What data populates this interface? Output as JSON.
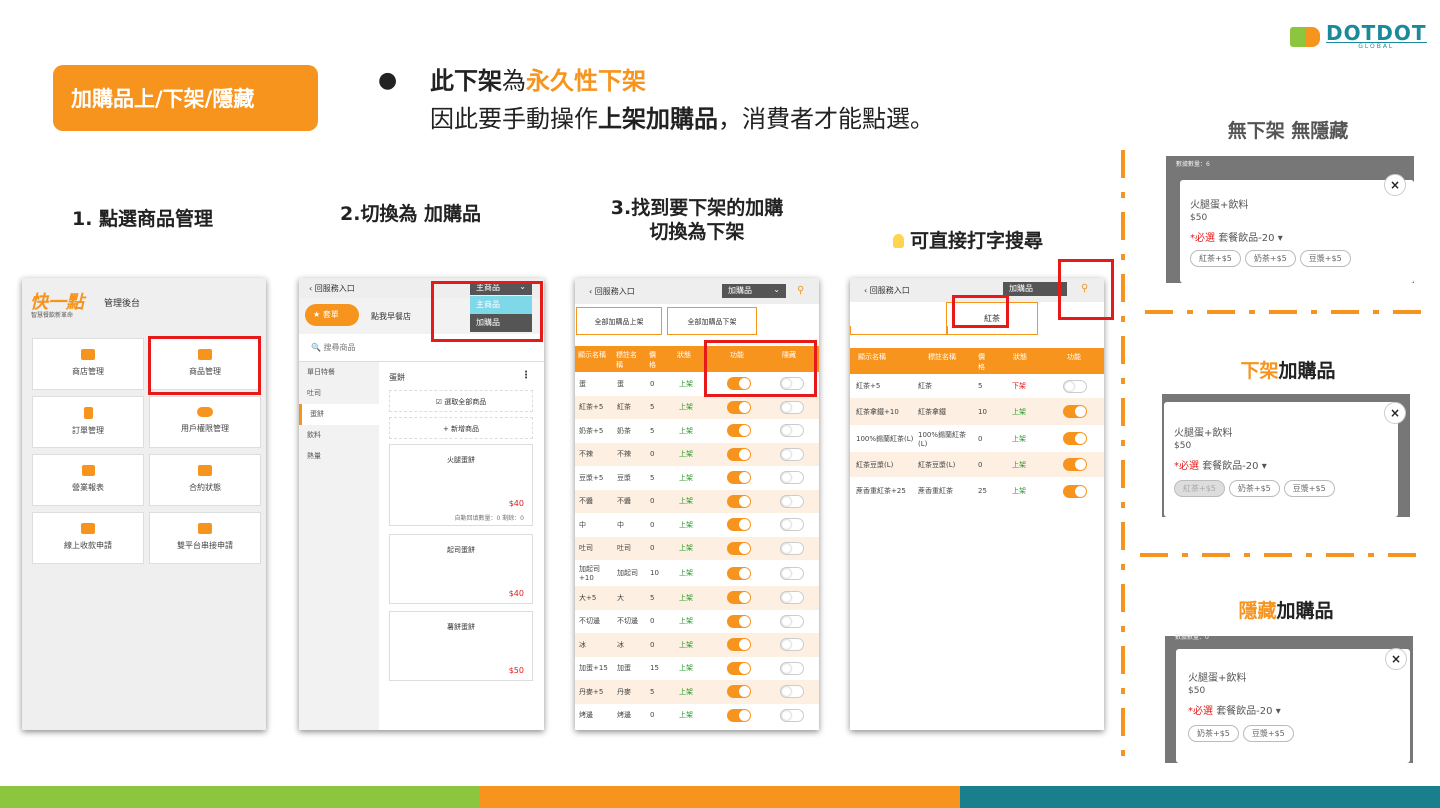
{
  "title_button": "加購品上/下架/隱藏",
  "bullet": {
    "l1_a": "此下架",
    "l1_b": "為",
    "l1_c": "永久性下架",
    "l2_a": "因此要手動操作",
    "l2_b": "上架加購品",
    "l2_c": "，消費者才能點選。"
  },
  "logo": {
    "name": "DOTDOT",
    "sub": "GLOBAL"
  },
  "steps": {
    "s1": "1. 點選商品管理",
    "s2": "2.切換為 加購品",
    "s3a": "3.找到要下架的加購",
    "s3b": "切換為下架",
    "s4": "可直接打字搜尋"
  },
  "panel1": {
    "brand": "快一點",
    "brand_sub": "智慧餐飲新革命",
    "manager": "管理後台",
    "tiles": [
      "商店管理",
      "商品管理",
      "訂單管理",
      "用戶權限管理",
      "營業報表",
      "合約狀態",
      "線上收款申請",
      "雙平台串接申請"
    ]
  },
  "panel2": {
    "back": "回服務入口",
    "select": "主商品",
    "options": [
      "主商品",
      "加購品"
    ],
    "star_tab": "套單",
    "tab2": "點我早餐店",
    "search": "搜尋商品",
    "side": [
      "單日特餐",
      "吐司",
      "蛋餅",
      "飲料",
      "熱量"
    ],
    "section": "蛋餅",
    "select_all": "選取全部商品",
    "add_item": "+ 新增商品",
    "cards": [
      {
        "name": "火腿蛋餅",
        "price": "$40",
        "note": "自動回填數量：0   剩餘：0"
      },
      {
        "name": "起司蛋餅",
        "price": "$40"
      },
      {
        "name": "薯餅蛋餅",
        "price": "$50"
      }
    ]
  },
  "panel3": {
    "back": "回服務入口",
    "select": "加購品",
    "btn_up": "全部加購品上架",
    "btn_down": "全部加購品下架",
    "headers": [
      "顯示名稱",
      "標註名稱",
      "價格",
      "狀態",
      "功能",
      "隱藏"
    ],
    "rows": [
      [
        "蛋",
        "蛋",
        "0",
        "上架"
      ],
      [
        "紅茶+5",
        "紅茶",
        "5",
        "上架"
      ],
      [
        "奶茶+5",
        "奶茶",
        "5",
        "上架"
      ],
      [
        "不辣",
        "不辣",
        "0",
        "上架"
      ],
      [
        "豆漿+5",
        "豆漿",
        "5",
        "上架"
      ],
      [
        "不醬",
        "不醬",
        "0",
        "上架"
      ],
      [
        "中",
        "中",
        "0",
        "上架"
      ],
      [
        "吐司",
        "吐司",
        "0",
        "上架"
      ],
      [
        "加起司+10",
        "加起司",
        "10",
        "上架"
      ],
      [
        "大+5",
        "大",
        "5",
        "上架"
      ],
      [
        "不切邊",
        "不切邊",
        "0",
        "上架"
      ],
      [
        "冰",
        "冰",
        "0",
        "上架"
      ],
      [
        "加蛋+15",
        "加蛋",
        "15",
        "上架"
      ],
      [
        "丹麥+5",
        "丹麥",
        "5",
        "上架"
      ],
      [
        "烤邊",
        "烤邊",
        "0",
        "上架"
      ]
    ]
  },
  "panel4": {
    "back": "回服務入口",
    "select": "加購品",
    "search_text": "紅茶",
    "headers": [
      "顯示名稱",
      "標註名稱",
      "價格",
      "狀態",
      "功能"
    ],
    "rows": [
      [
        "紅茶+5",
        "紅茶",
        "5",
        "下架",
        "off"
      ],
      [
        "紅茶拿鐵+10",
        "紅茶拿鐵",
        "10",
        "上架",
        "on"
      ],
      [
        "100%錫蘭紅茶(L)",
        "100%錫蘭紅茶(L)",
        "0",
        "上架",
        "on"
      ],
      [
        "紅茶豆漿(L)",
        "紅茶豆漿(L)",
        "0",
        "上架",
        "on"
      ],
      [
        "蔗香重紅茶+25",
        "蔗香重紅茶",
        "25",
        "上架",
        "on"
      ]
    ]
  },
  "right": {
    "label1": "無下架 無隱藏",
    "label2_a": "下架",
    "label2_b": "加購品",
    "label3_a": "隱藏",
    "label3_b": "加購品",
    "card_title": "火腿蛋+飲料",
    "card_price": "$50",
    "required": "*必選",
    "group": "套餐飲品-20",
    "top_text1": "數據數量：6",
    "top_text3": "數據數量：0",
    "pills1": [
      "紅茶+$5",
      "奶茶+$5",
      "豆漿+$5"
    ],
    "pills2": [
      "紅茶+$5",
      "奶茶+$5",
      "豆漿+$5"
    ],
    "pills3": [
      "奶茶+$5",
      "豆漿+$5"
    ]
  },
  "colors": {
    "accent": "#f7941d",
    "red": "#e81919",
    "green": "#8cc63f",
    "teal": "#1a8a9a"
  }
}
